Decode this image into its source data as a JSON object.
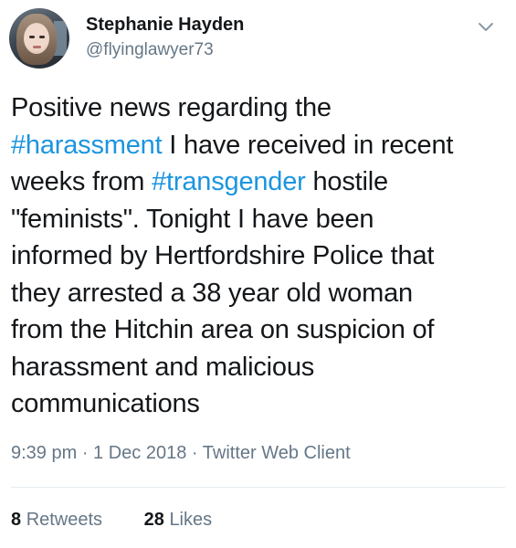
{
  "author": {
    "name": "Stephanie Hayden",
    "handle": "@flyinglawyer73"
  },
  "tweet": {
    "lines": [
      [
        {
          "t": "Positive news regarding the"
        }
      ],
      [
        {
          "t": "#harassment",
          "tag": true
        },
        {
          "t": " I have received in recent"
        }
      ],
      [
        {
          "t": "weeks from "
        },
        {
          "t": "#transgender",
          "tag": true
        },
        {
          "t": " hostile"
        }
      ],
      [
        {
          "t": "\"feminists\". Tonight I have been"
        }
      ],
      [
        {
          "t": "informed by Hertfordshire Police that"
        }
      ],
      [
        {
          "t": "they arrested a 38 year old woman"
        }
      ],
      [
        {
          "t": "from the Hitchin area on suspicion of"
        }
      ],
      [
        {
          "t": "harassment and malicious"
        }
      ],
      [
        {
          "t": "communications"
        }
      ]
    ]
  },
  "meta": {
    "time": "9:39 pm",
    "sep1": " · ",
    "date": "1 Dec 2018",
    "sep2": " · ",
    "client": "Twitter Web Client"
  },
  "stats": {
    "retweets_count": "8",
    "retweets_label": "Retweets",
    "likes_count": "28",
    "likes_label": "Likes"
  },
  "colors": {
    "hashtag": "#1b95e0",
    "secondary_text": "#657786",
    "primary_text": "#14171a"
  },
  "icons": {
    "menu": "chevron-down-icon"
  }
}
